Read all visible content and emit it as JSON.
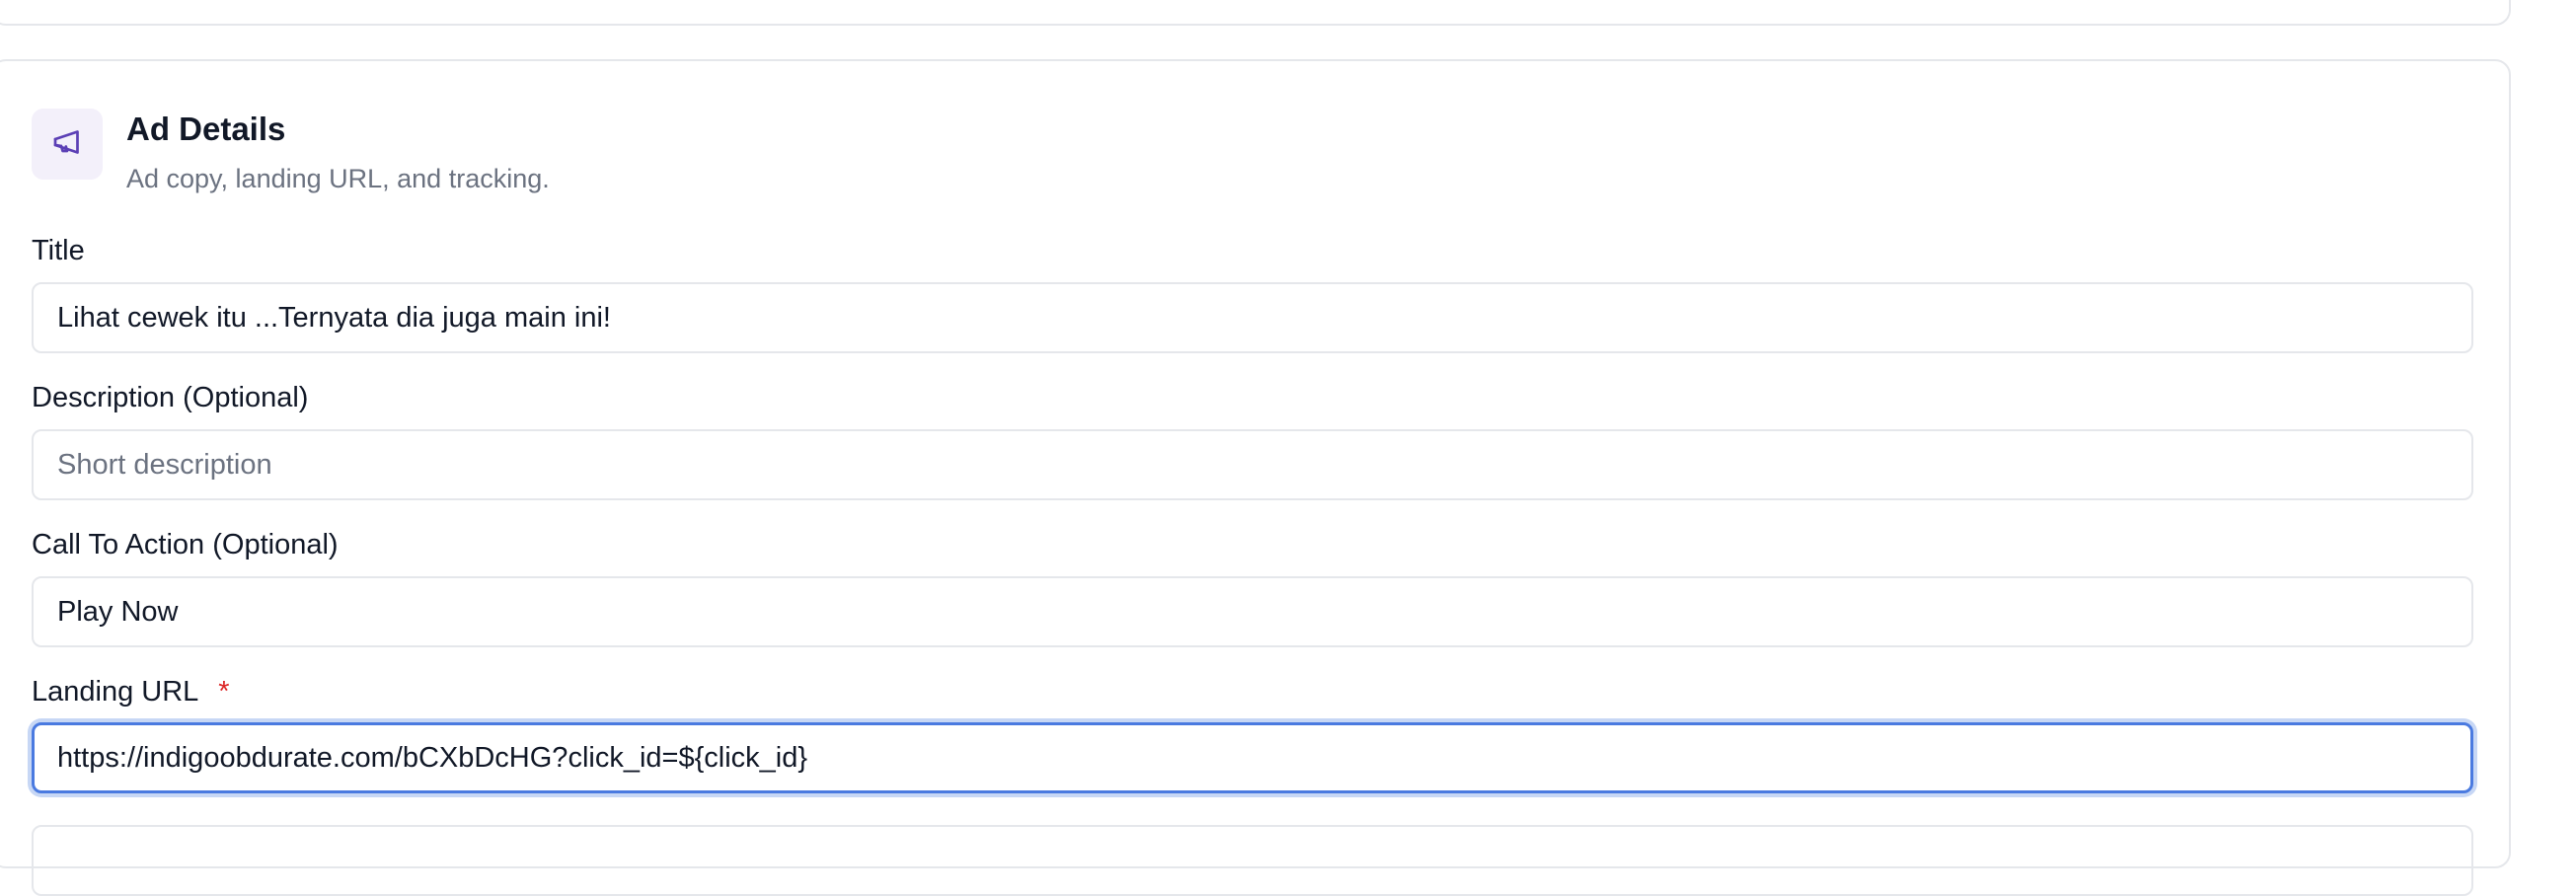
{
  "section": {
    "icon": "megaphone-icon",
    "title": "Ad Details",
    "subtitle": "Ad copy, landing URL, and tracking."
  },
  "fields": {
    "title": {
      "label": "Title",
      "value": "Lihat cewek itu ...Ternyata dia juga main ini!"
    },
    "description": {
      "label": "Description (Optional)",
      "value": "",
      "placeholder": "Short description"
    },
    "cta": {
      "label": "Call To Action (Optional)",
      "value": "Play Now"
    },
    "landing_url": {
      "label": "Landing URL",
      "required_mark": "*",
      "value": "https://indigoobdurate.com/bCXbDcHG?click_id=${click_id}"
    }
  },
  "colors": {
    "accent": "#4a7ae0",
    "icon": "#5b3fb5",
    "icon_bg": "#f3f0fa",
    "required": "#dc2626"
  }
}
